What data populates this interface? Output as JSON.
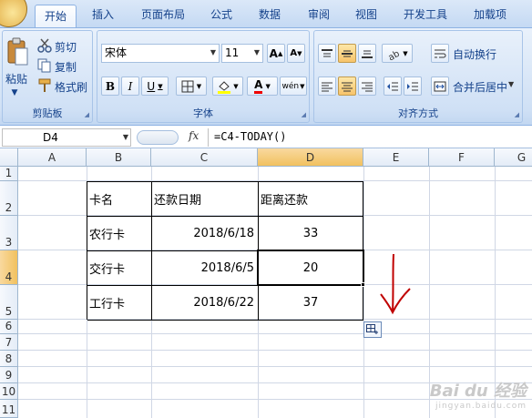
{
  "tabs": [
    "开始",
    "插入",
    "页面布局",
    "公式",
    "数据",
    "审阅",
    "视图",
    "开发工具",
    "加载项"
  ],
  "clipboard": {
    "paste": "粘贴",
    "cut": "剪切",
    "copy": "复制",
    "format_painter": "格式刷",
    "group": "剪贴板"
  },
  "font": {
    "name": "宋体",
    "size": "11",
    "group": "字体",
    "bold": "B",
    "italic": "I",
    "underline": "U",
    "font_color": "A",
    "grow": "A",
    "shrink": "A",
    "phonetic": "wén"
  },
  "alignment": {
    "wrap": "自动换行",
    "merge": "合并后居中",
    "group": "对齐方式"
  },
  "name_box": "D4",
  "fx": "fx",
  "formula": "=C4-TODAY()",
  "columns": [
    "A",
    "B",
    "C",
    "D",
    "E",
    "F",
    "G"
  ],
  "rows": [
    "1",
    "2",
    "3",
    "4",
    "5",
    "6",
    "7",
    "8",
    "9",
    "10",
    "11"
  ],
  "table": {
    "header": [
      "卡名",
      "还款日期",
      "距离还款"
    ],
    "rows": [
      [
        "农行卡",
        "2018/6/18",
        "33"
      ],
      [
        "交行卡",
        "2018/6/5",
        "20"
      ],
      [
        "工行卡",
        "2018/6/22",
        "37"
      ]
    ]
  },
  "watermark": {
    "main": "Bai du 经验",
    "sub": "jingyan.baidu.com"
  },
  "annotation_color": "#c00000",
  "accent_selected": "#f1c15f"
}
